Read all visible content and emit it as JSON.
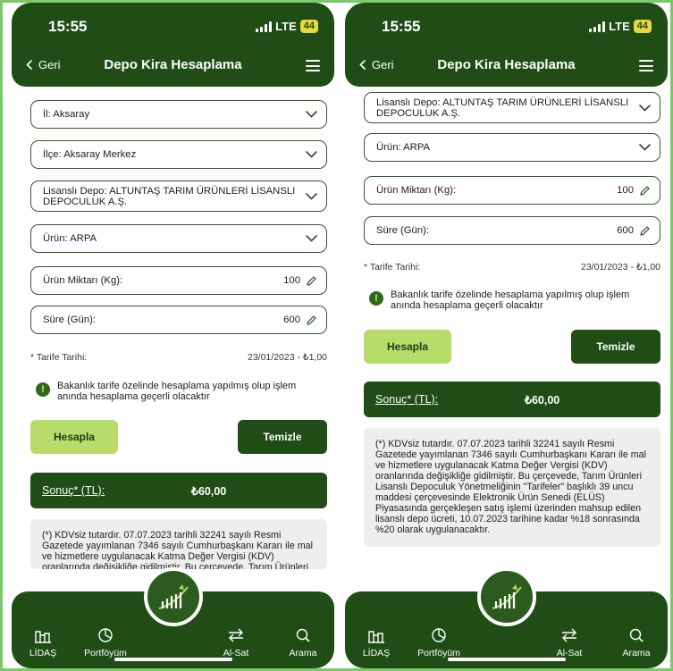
{
  "status": {
    "time": "15:55",
    "network": "LTE",
    "battery": "44"
  },
  "header": {
    "back_label": "Geri",
    "title": "Depo Kira Hesaplama"
  },
  "fields": {
    "il": "İl: Aksaray",
    "ilce": "İlçe: Aksaray Merkez",
    "depo": "Lisanslı Depo: ALTUNTAŞ TARIM ÜRÜNLERİ LİSANSLI DEPOCULUK A.Ş.",
    "urun": "Ürün: ARPA",
    "miktar_label": "Ürün Miktarı (Kg):",
    "miktar_value": "100",
    "sure_label": "Süre (Gün):",
    "sure_value": "600"
  },
  "tarife": {
    "label": "* Tarife Tarihi:",
    "value": "23/01/2023 - ₺1,00"
  },
  "info_text": "Bakanlık tarife özelinde hesaplama yapılmış olup işlem anında hesaplama geçerli olacaktır",
  "buttons": {
    "calculate": "Hesapla",
    "clear": "Temizle"
  },
  "result": {
    "label": "Sonuç* (TL):",
    "value": "₺60,00"
  },
  "note": "(*) KDVsiz tutardır. 07.07.2023 tarihli 32241 sayılı Resmi Gazetede yayımlanan 7346 sayılı Cumhurbaşkanı Kararı ile mal ve hizmetlere uygulanacak Katma Değer Vergisi (KDV) oranlarında değişikliğe gidilmiştir. Bu çerçevede, Tarım Ürünleri Lisanslı Depoculuk Yönetmeliğinin \"Tarifeler\" başlıklı 39 uncu maddesi çerçevesinde Elektronik Ürün Senedi (ELÜS) Piyasasında gerçekleşen satış işlemi üzerinden mahsup edilen lisanslı depo ücreti, 10.07.2023 tarihine kadar %18 sonrasında %20 olarak uygulanacaktır.",
  "tabs": {
    "lidas": "LİDAŞ",
    "portfoy": "Portföyüm",
    "alsat": "Al-Sat",
    "arama": "Arama"
  },
  "colors": {
    "primary": "#1f4d15",
    "accent": "#b7dc6a",
    "frame": "#7bc96b"
  }
}
